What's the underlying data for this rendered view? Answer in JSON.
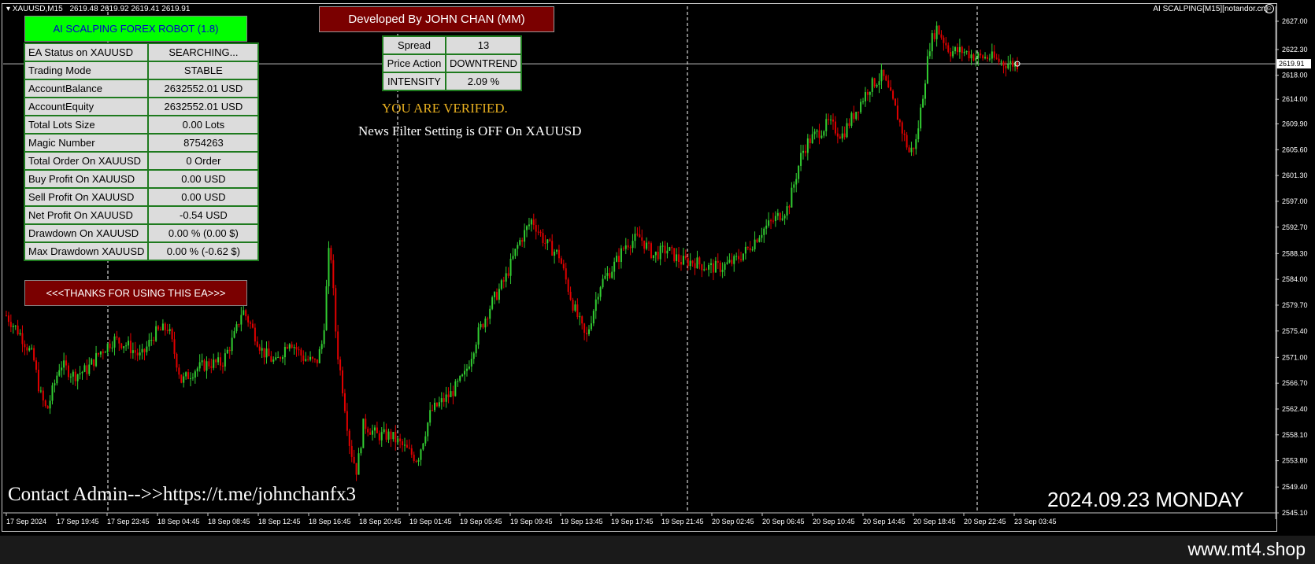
{
  "header": {
    "symbol": "XAUUSD,M15",
    "quotes": "2619.48 2619.92 2619.41 2619.91",
    "ea_label": "AI SCALPING[M15][notandor.cn]",
    "smile_icon": "smile-icon"
  },
  "robot_title": "AI SCALPING FOREX ROBOT (1.8)",
  "main_table": [
    {
      "key": "EA Status on XAUUSD",
      "value": "SEARCHING..."
    },
    {
      "key": "Trading Mode",
      "value": "STABLE"
    },
    {
      "key": "AccountBalance",
      "value": "2632552.01 USD"
    },
    {
      "key": "AccountEquity",
      "value": "2632552.01 USD"
    },
    {
      "key": "Total Lots Size",
      "value": "0.00 Lots"
    },
    {
      "key": "Magic Number",
      "value": "8754263"
    },
    {
      "key": "Total Order On XAUUSD",
      "value": "0 Order"
    },
    {
      "key": "Buy Profit On XAUUSD",
      "value": "0.00 USD"
    },
    {
      "key": "Sell Profit On XAUUSD",
      "value": "0.00 USD"
    },
    {
      "key": "Net Profit On XAUUSD",
      "value": "-0.54 USD"
    },
    {
      "key": "Drawdown On XAUUSD",
      "value": "0.00 % (0.00 $)"
    },
    {
      "key": "Max Drawdown XAUUSD",
      "value": "0.00 % (-0.62 $)"
    }
  ],
  "thanks_banner": "<<<THANKS FOR USING THIS EA>>>",
  "dev_banner": "Developed By JOHN CHAN (MM)",
  "mini_table": [
    {
      "key": "Spread",
      "value": "13"
    },
    {
      "key": "Price Action",
      "value": "DOWNTREND"
    },
    {
      "key": "INTENSITY",
      "value": "2.09 %"
    }
  ],
  "verified_text": "YOU ARE VERIFIED.",
  "news_text": "News Filter Setting is OFF On XAUUSD",
  "contact_text": "Contact Admin-->>https://t.me/johnchanfx3",
  "date_stamp": "2024.09.23 MONDAY",
  "watermark": "www.mt4.shop",
  "colors": {
    "background": "#000000",
    "bull_candle": "#32cd32",
    "bear_candle": "#e00000",
    "grid": "#ffffff",
    "title_bg": "#00ff00",
    "banner_bg": "#7a0000",
    "verified": "#e8b020"
  },
  "chart_data": {
    "type": "candlestick",
    "price_axis": [
      "2627.00",
      "2622.30",
      "2618.00",
      "2614.00",
      "2609.90",
      "2605.60",
      "2601.30",
      "2597.00",
      "2592.70",
      "2588.30",
      "2584.00",
      "2579.70",
      "2575.40",
      "2571.00",
      "2566.70",
      "2562.40",
      "2558.10",
      "2553.80",
      "2549.40",
      "2545.10"
    ],
    "current_price": "2619.91",
    "ylim": [
      2545.1,
      2627.0
    ],
    "time_axis": [
      "17 Sep 2024",
      "17 Sep 19:45",
      "17 Sep 23:45",
      "18 Sep 04:45",
      "18 Sep 08:45",
      "18 Sep 12:45",
      "18 Sep 16:45",
      "18 Sep 20:45",
      "19 Sep 01:45",
      "19 Sep 05:45",
      "19 Sep 09:45",
      "19 Sep 13:45",
      "19 Sep 17:45",
      "19 Sep 21:45",
      "20 Sep 02:45",
      "20 Sep 06:45",
      "20 Sep 10:45",
      "20 Sep 14:45",
      "20 Sep 18:45",
      "20 Sep 22:45",
      "23 Sep 03:45"
    ],
    "price_path": [
      [
        0,
        2578
      ],
      [
        2,
        2575
      ],
      [
        4,
        2571
      ],
      [
        5,
        2565
      ],
      [
        6,
        2562
      ],
      [
        7,
        2566
      ],
      [
        8,
        2570
      ],
      [
        10,
        2568
      ],
      [
        12,
        2569
      ],
      [
        14,
        2572
      ],
      [
        16,
        2574
      ],
      [
        18,
        2573
      ],
      [
        20,
        2571
      ],
      [
        22,
        2575
      ],
      [
        24,
        2576
      ],
      [
        26,
        2567
      ],
      [
        28,
        2569
      ],
      [
        30,
        2570
      ],
      [
        32,
        2570
      ],
      [
        34,
        2575
      ],
      [
        35,
        2579
      ],
      [
        36,
        2577
      ],
      [
        38,
        2572
      ],
      [
        40,
        2570
      ],
      [
        42,
        2574
      ],
      [
        44,
        2571
      ],
      [
        46,
        2570
      ],
      [
        47,
        2574
      ],
      [
        48,
        2591
      ],
      [
        49,
        2573
      ],
      [
        50,
        2565
      ],
      [
        51,
        2556
      ],
      [
        52,
        2552
      ],
      [
        53,
        2560
      ],
      [
        55,
        2558
      ],
      [
        57,
        2558
      ],
      [
        59,
        2556
      ],
      [
        61,
        2554
      ],
      [
        63,
        2562
      ],
      [
        66,
        2565
      ],
      [
        68,
        2568
      ],
      [
        70,
        2575
      ],
      [
        72,
        2580
      ],
      [
        74,
        2584
      ],
      [
        76,
        2590
      ],
      [
        78,
        2594
      ],
      [
        80,
        2590
      ],
      [
        82,
        2588
      ],
      [
        84,
        2580
      ],
      [
        86,
        2574
      ],
      [
        88,
        2583
      ],
      [
        90,
        2586
      ],
      [
        92,
        2590
      ],
      [
        94,
        2591
      ],
      [
        96,
        2588
      ],
      [
        98,
        2589
      ],
      [
        100,
        2587
      ],
      [
        102,
        2587
      ],
      [
        104,
        2586
      ],
      [
        106,
        2586
      ],
      [
        108,
        2587
      ],
      [
        110,
        2589
      ],
      [
        112,
        2592
      ],
      [
        114,
        2594
      ],
      [
        116,
        2596
      ],
      [
        118,
        2605
      ],
      [
        119,
        2607
      ],
      [
        120,
        2608
      ],
      [
        122,
        2610
      ],
      [
        124,
        2608
      ],
      [
        126,
        2612
      ],
      [
        128,
        2616
      ],
      [
        130,
        2618
      ],
      [
        132,
        2612
      ],
      [
        134,
        2605
      ],
      [
        135,
        2607
      ],
      [
        136,
        2615
      ],
      [
        137,
        2623
      ],
      [
        138,
        2626
      ],
      [
        139,
        2624
      ],
      [
        140,
        2622
      ],
      [
        142,
        2622
      ],
      [
        144,
        2621
      ],
      [
        146,
        2621
      ],
      [
        148,
        2620
      ],
      [
        150,
        2619.9
      ]
    ]
  }
}
